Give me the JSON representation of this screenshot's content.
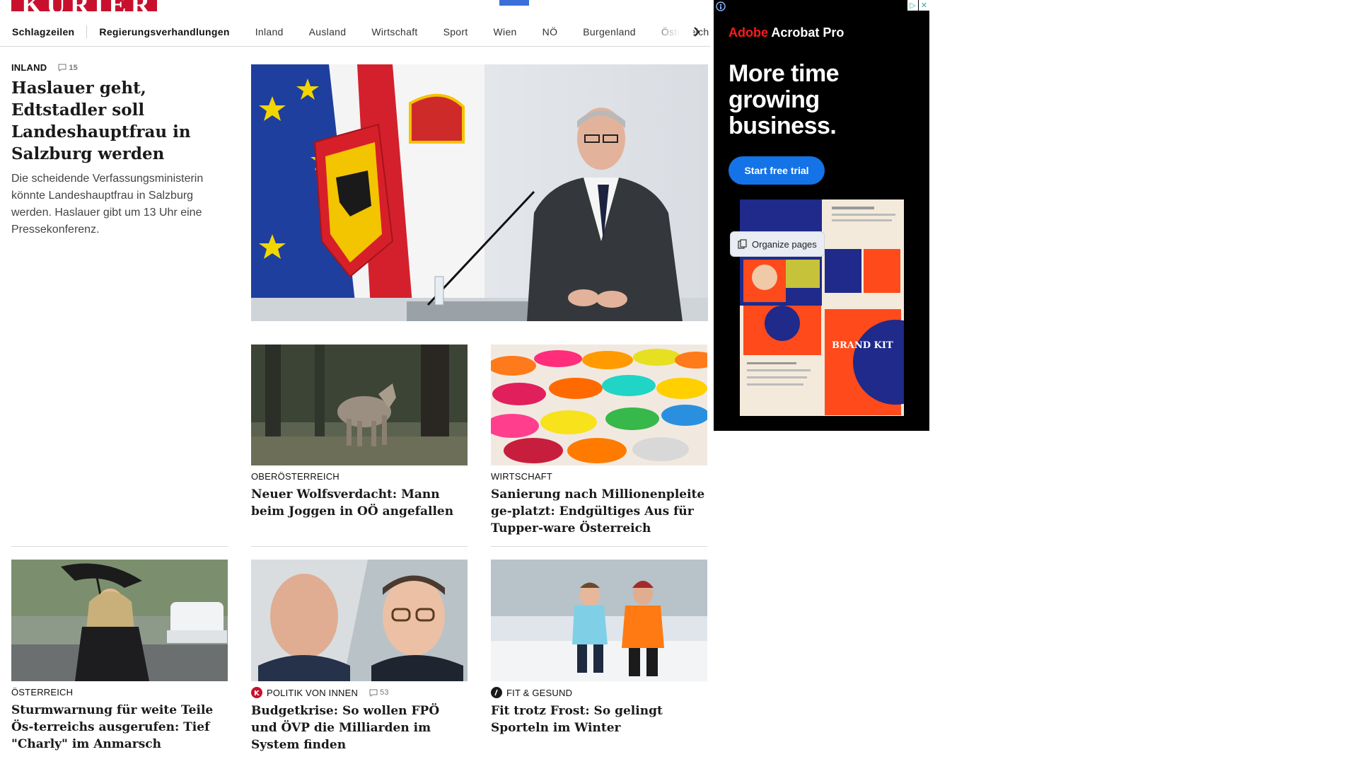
{
  "logo": {
    "text": "KURIER"
  },
  "nav": {
    "items": [
      {
        "label": "Schlagzeilen",
        "bold": true
      },
      {
        "label": "Regierungsverhandlungen",
        "bold": true
      },
      {
        "label": "Inland",
        "bold": false
      },
      {
        "label": "Ausland",
        "bold": false
      },
      {
        "label": "Wirtschaft",
        "bold": false
      },
      {
        "label": "Sport",
        "bold": false
      },
      {
        "label": "Wien",
        "bold": false
      },
      {
        "label": "NÖ",
        "bold": false
      },
      {
        "label": "Burgenland",
        "bold": false
      },
      {
        "label": "Österreich",
        "bold": false
      }
    ]
  },
  "lead": {
    "category": "INLAND",
    "comments": "15",
    "headline": "Haslauer geht, Edtstadler soll Landeshauptfrau in Salzburg werden",
    "teaser": "Die scheidende Verfassungsministerin könnte Landeshauptfrau in Salzburg werden. Haslauer gibt um 13 Uhr eine Pressekonferenz."
  },
  "cards": {
    "wolf": {
      "category": "OBERÖSTERREICH",
      "headline": "Neuer Wolfsverdacht: Mann beim Joggen in OÖ angefallen"
    },
    "tupper": {
      "category": "WIRTSCHAFT",
      "headline": "Sanierung nach Millionenpleite ge-platzt: Endgültiges Aus für Tupper-ware Österreich"
    },
    "storm": {
      "category": "ÖSTERREICH",
      "headline": "Sturmwarnung für weite Teile Ös-terreichs ausgerufen: Tief \"Charly\" im Anmarsch"
    },
    "budget": {
      "category": "POLITIK VON INNEN",
      "comments": "53",
      "headline": "Budgetkrise: So wollen FPÖ und ÖVP die Milliarden im System finden"
    },
    "frost": {
      "category": "FIT & GESUND",
      "headline": "Fit trotz Frost: So gelingt Sporteln im Winter"
    }
  },
  "ad": {
    "brand_prefix": "Adobe",
    "brand_suffix": " Acrobat Pro",
    "headline": "More time growing business.",
    "cta": "Start free trial",
    "tooltip": "Organize pages",
    "card_brand_kit": "BRAND KIT"
  },
  "colors": {
    "brand_red": "#c8102e",
    "ad_blue": "#1473e6"
  }
}
